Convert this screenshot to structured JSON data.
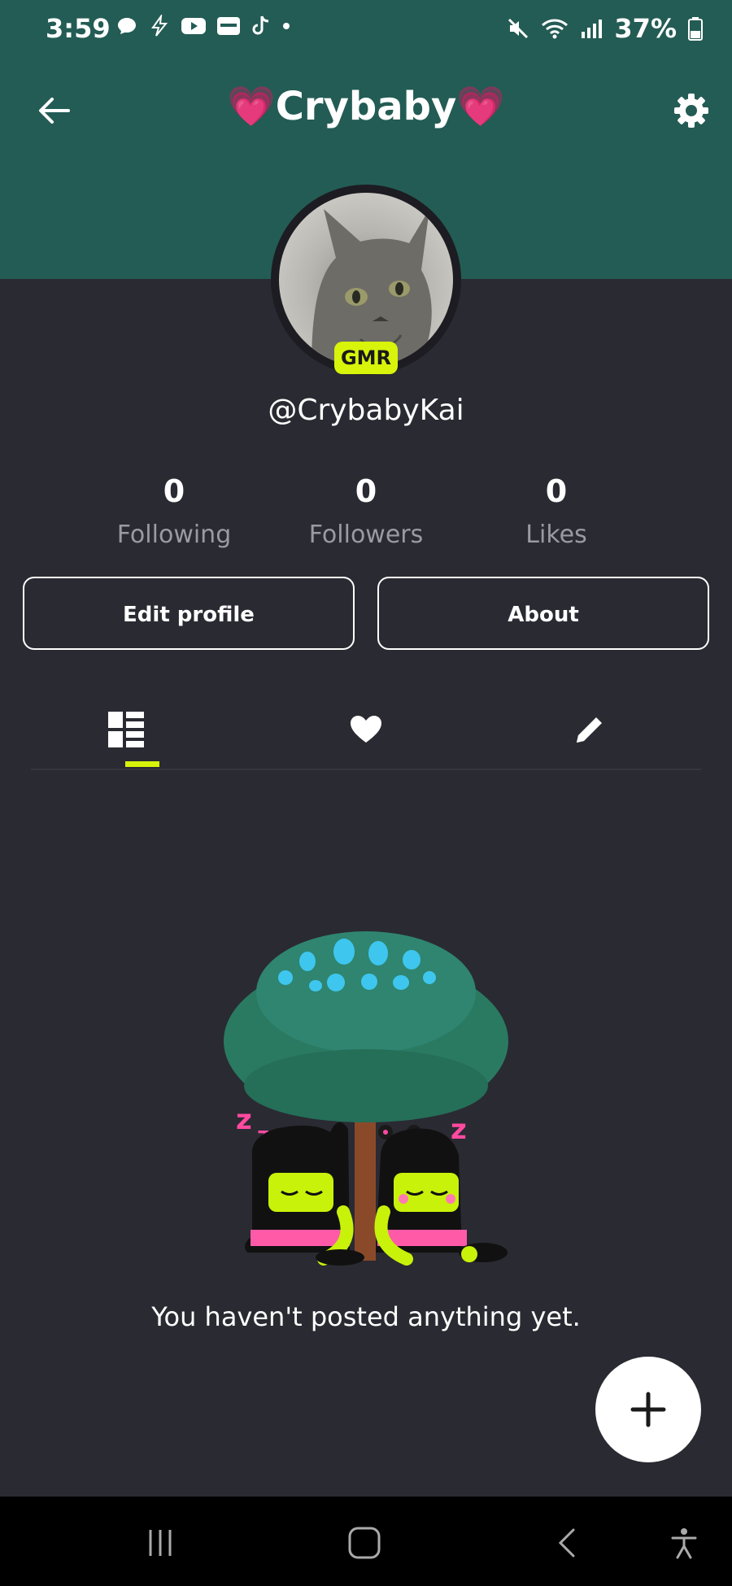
{
  "status_bar": {
    "time": "3:59",
    "battery": "37%",
    "icons_left": [
      "messages-icon",
      "lightning-icon",
      "youtube-icon",
      "samsung-icon",
      "tiktok-icon",
      "dot-icon"
    ],
    "icons_right": [
      "mute-icon",
      "wifi-icon",
      "signal-icon",
      "battery-icon"
    ]
  },
  "header": {
    "title": "💗Crybaby💗",
    "bg_color": "#235c54"
  },
  "profile": {
    "badge": "GMR",
    "username": "@CrybabyKai"
  },
  "stats": [
    {
      "value": "0",
      "label": "Following"
    },
    {
      "value": "0",
      "label": "Followers"
    },
    {
      "value": "0",
      "label": "Likes"
    }
  ],
  "buttons": {
    "edit_profile": "Edit profile",
    "about": "About"
  },
  "tabs": [
    {
      "name": "posts",
      "icon": "grid-icon",
      "active": true
    },
    {
      "name": "likes",
      "icon": "heart-icon",
      "active": false
    },
    {
      "name": "drafts",
      "icon": "pencil-icon",
      "active": false
    }
  ],
  "empty_state": {
    "message": "You haven't posted anything yet."
  },
  "colors": {
    "accent": "#d7f40a",
    "background": "#2a2a32",
    "header": "#235c54"
  }
}
